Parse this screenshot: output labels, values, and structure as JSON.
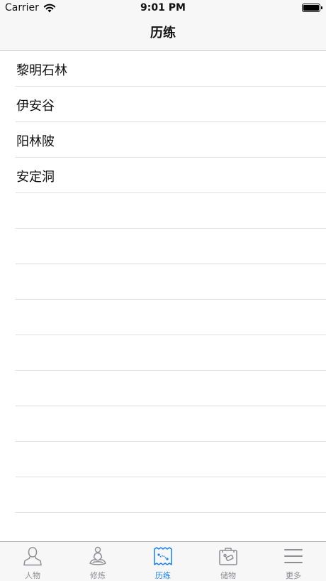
{
  "status_bar": {
    "carrier": "Carrier",
    "time": "9:01 PM"
  },
  "nav": {
    "title": "历练"
  },
  "list": {
    "items": [
      {
        "label": "黎明石林"
      },
      {
        "label": "伊安谷"
      },
      {
        "label": "阳林陂"
      },
      {
        "label": "安定洞"
      },
      {
        "label": ""
      },
      {
        "label": ""
      },
      {
        "label": ""
      },
      {
        "label": ""
      },
      {
        "label": ""
      },
      {
        "label": ""
      },
      {
        "label": ""
      },
      {
        "label": ""
      },
      {
        "label": ""
      },
      {
        "label": ""
      }
    ]
  },
  "tab_bar": {
    "tabs": [
      {
        "label": "人物",
        "icon": "person-icon",
        "active": false
      },
      {
        "label": "修炼",
        "icon": "meditation-icon",
        "active": false
      },
      {
        "label": "历练",
        "icon": "map-icon",
        "active": true
      },
      {
        "label": "储物",
        "icon": "briefcase-icon",
        "active": false
      },
      {
        "label": "更多",
        "icon": "menu-icon",
        "active": false
      }
    ]
  },
  "colors": {
    "accent": "#147efb",
    "inactive": "#8e8e93",
    "bar_bg": "#f7f7f7",
    "separator": "#e0e0e3"
  }
}
